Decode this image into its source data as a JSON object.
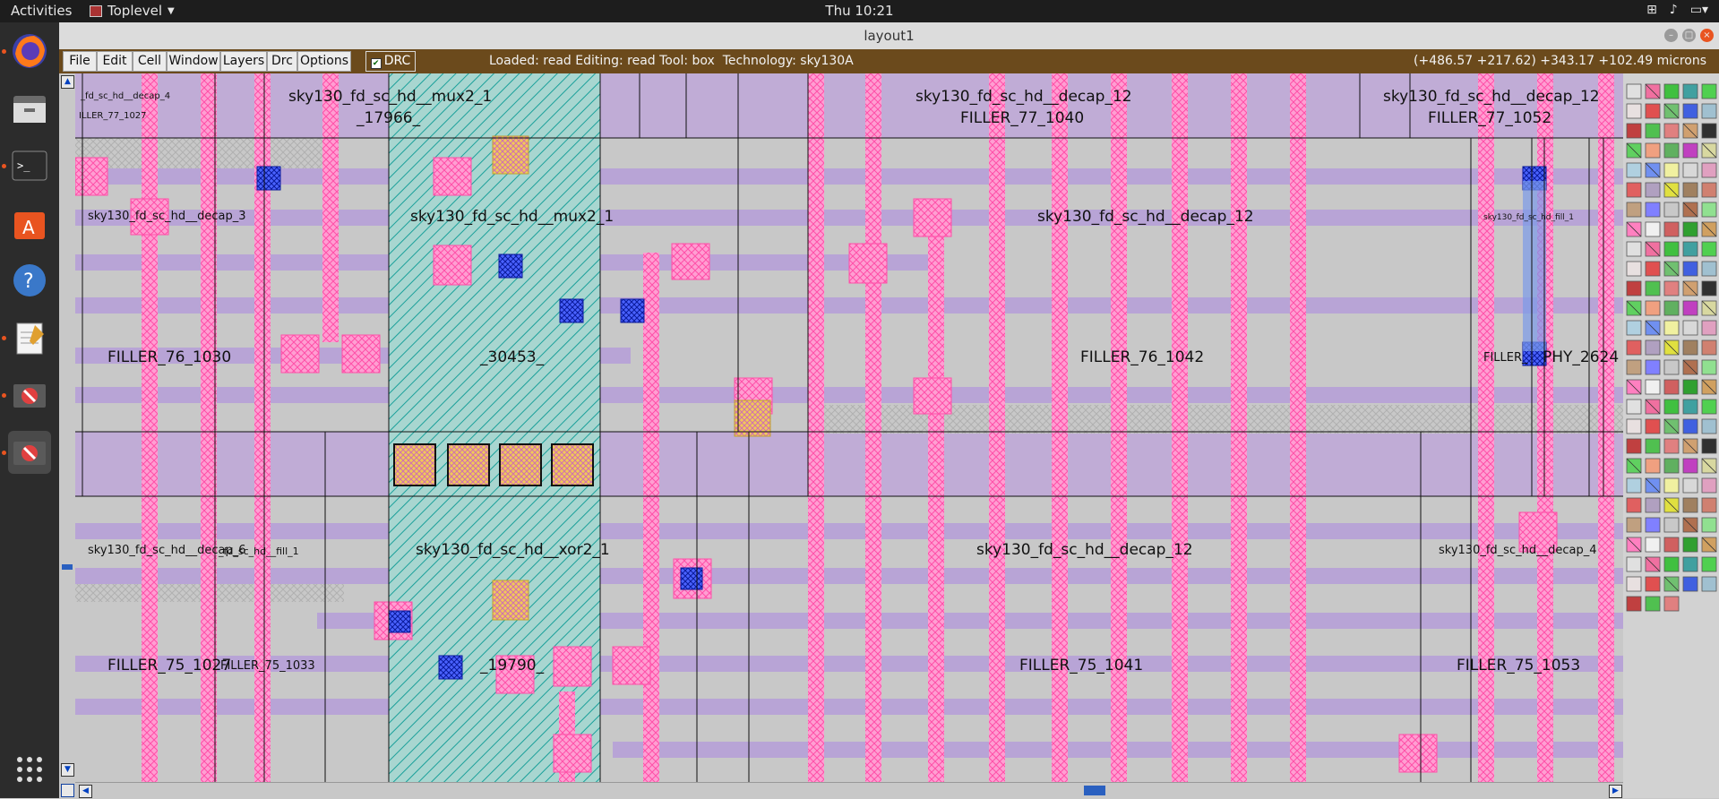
{
  "topbar": {
    "activities": "Activities",
    "app_name": "Toplevel",
    "clock": "Thu 10:21"
  },
  "dock": {
    "items": [
      "firefox-icon",
      "files-icon",
      "terminal-icon",
      "software-icon",
      "help-icon",
      "text-editor-icon",
      "stop-app-icon",
      "stop-app-icon"
    ]
  },
  "window": {
    "title": "layout1"
  },
  "menu": {
    "file": "File",
    "edit": "Edit",
    "cell": "Cell",
    "window": "Window",
    "layers": "Layers",
    "drc_menu": "Drc",
    "options": "Options",
    "drc_toggle": "DRC",
    "status": "Loaded: read Editing: read Tool: box  Technology: sky130A",
    "coords": "(+486.57 +217.62) +343.17 +102.49 microns"
  },
  "colors": {
    "menubar": "#6b4a1c",
    "row_band": "#c0acd6",
    "metal1": "#b8a4d6",
    "poly": "#ff80c0",
    "cell_hatch": "#00a0a0",
    "via": "#2030ff",
    "contact": "#e0c050"
  },
  "cells": {
    "decap4_top": "_fd_sc_hd__decap_4",
    "filler77_1027": "ILLER_77_1027",
    "mux2_top": "sky130_fd_sc_hd__mux2_1",
    "inst_17966": "_17966_",
    "decap12_top": "sky130_fd_sc_hd__decap_12",
    "filler77_1040": "FILLER_77_1040",
    "decap12_top_right": "sky130_fd_sc_hd__decap_12",
    "filler77_1052": "FILLER_77_1052",
    "decap3": "sky130_fd_sc_hd__decap_3",
    "mux2_mid": "sky130_fd_sc_hd__mux2_1",
    "decap12_mid": "sky130_fd_sc_hd__decap_12",
    "right_cluster": "sky130_fd_sc_hd_fill_1",
    "filler76_1030": "FILLER_76_1030",
    "inst_30453": "_30453_",
    "filler76_1042": "FILLER_76_1042",
    "filler_phy": "FILLER_",
    "phy_2624": "PHY_2624",
    "decap6": "sky130_fd_sc_hd__decap_6",
    "fill1": "_fd_sc_hd__fill_1",
    "xor2": "sky130_fd_sc_hd__xor2_1",
    "decap12_low": "sky130_fd_sc_hd__decap_12",
    "decap4_low": "sky130_fd_sc_hd__decap_4",
    "filler75_1027": "FILLER_75_1027",
    "filler75_1033": "FILLER_75_1033",
    "inst_19790": "_19790_",
    "filler75_1041": "FILLER_75_1041",
    "filler75_1053": "FILLER_75_1053"
  }
}
